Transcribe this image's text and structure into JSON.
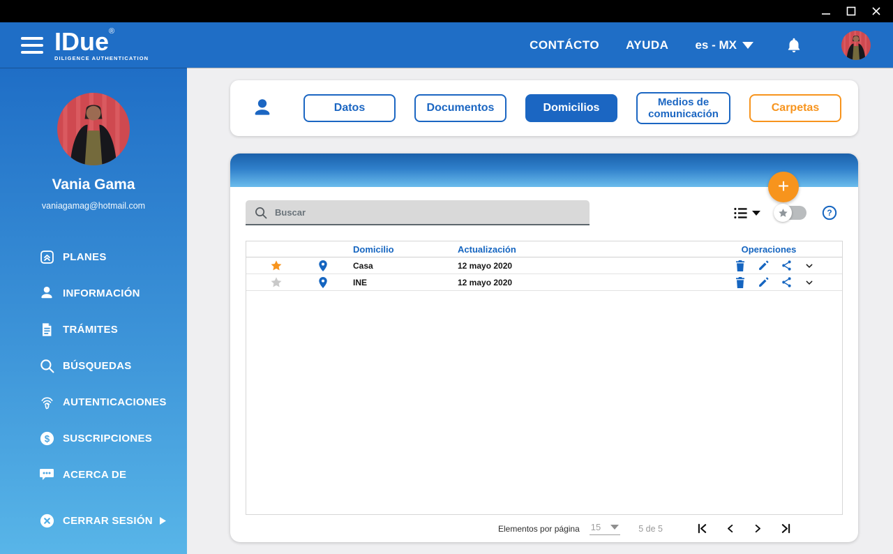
{
  "window": {
    "controls": [
      {
        "icon": "minimize-icon"
      },
      {
        "icon": "maximize-icon"
      },
      {
        "icon": "close-icon"
      }
    ]
  },
  "header": {
    "logo_title": "IDue",
    "logo_registered": "®",
    "logo_subtitle": "DILIGENCE AUTHENTICATION",
    "nav_contact": "CONTÁCTO",
    "nav_help": "AYUDA",
    "language": "es - MX"
  },
  "sidebar": {
    "profile_name": "Vania Gama",
    "profile_email": "vaniagamag@hotmail.com",
    "items": [
      {
        "label": "PLANES",
        "icon": "plans-icon"
      },
      {
        "label": "INFORMACIÓN",
        "icon": "person-icon"
      },
      {
        "label": "TRÁMITES",
        "icon": "document-icon"
      },
      {
        "label": "BÚSQUEDAS",
        "icon": "search-icon"
      },
      {
        "label": "AUTENTICACIONES",
        "icon": "fingerprint-icon"
      },
      {
        "label": "SUSCRIPCIONES",
        "icon": "dollar-icon"
      },
      {
        "label": "ACERCA DE",
        "icon": "chat-icon"
      }
    ],
    "logout_label": "CERRAR SESIÓN"
  },
  "tabs": [
    {
      "label": "Datos",
      "active": false
    },
    {
      "label": "Documentos",
      "active": false
    },
    {
      "label": "Domicilios",
      "active": true
    },
    {
      "label": "Medios de comunicación",
      "active": false
    },
    {
      "label": "Carpetas",
      "active": false
    }
  ],
  "panel": {
    "search_placeholder": "Buscar",
    "table": {
      "col_domicilio": "Domicilio",
      "col_actualizacion": "Actualización",
      "col_operaciones": "Operaciones",
      "rows": [
        {
          "favorite": true,
          "domicilio": "Casa",
          "actualizacion": "12 mayo 2020"
        },
        {
          "favorite": false,
          "domicilio": "INE",
          "actualizacion": "12 mayo 2020"
        }
      ]
    },
    "pagination": {
      "per_page_label": "Elementos por página",
      "per_page_value": "15",
      "range": "5 de 5"
    }
  },
  "colors": {
    "header_blue": "#1f6ec6",
    "sidebar_gradient_end": "#58b5e8",
    "accent_blue": "#1b66c2",
    "accent_orange": "#f7941d",
    "star_inactive": "#c9c9c9"
  }
}
